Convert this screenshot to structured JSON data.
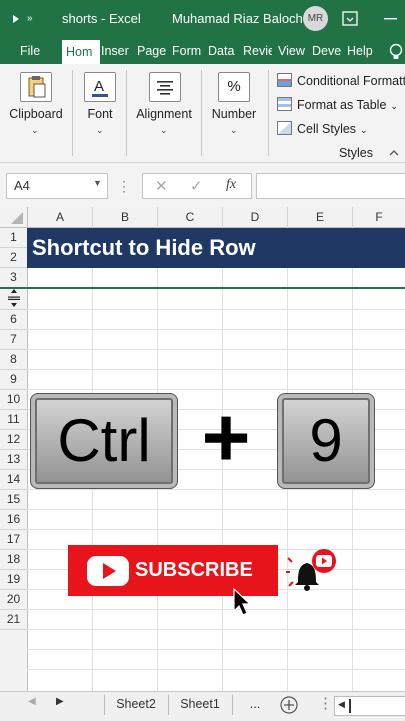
{
  "title_bar": {
    "app_title": "shorts  -  Excel",
    "user_name": "Muhamad Riaz Baloch",
    "user_initials": "MR",
    "accent_color": "#217346"
  },
  "tabs": [
    {
      "label": "File"
    },
    {
      "label": "Hom",
      "active": true
    },
    {
      "label": "Inser"
    },
    {
      "label": "Page"
    },
    {
      "label": "Form"
    },
    {
      "label": "Data"
    },
    {
      "label": "Revie"
    },
    {
      "label": "View"
    },
    {
      "label": "Deve"
    },
    {
      "label": "Help"
    }
  ],
  "ribbon": {
    "clipboard": "Clipboard",
    "font": "Font",
    "alignment": "Alignment",
    "number": "Number",
    "number_glyph": "%",
    "conditional_formatting": "Conditional Formatt",
    "format_as_table": "Format as Table",
    "cell_styles": "Cell Styles",
    "styles_group": "Styles"
  },
  "formula_bar": {
    "name_box": "A4",
    "fx_label": "fx",
    "formula": ""
  },
  "grid": {
    "columns": [
      "A",
      "B",
      "C",
      "D",
      "E",
      "F"
    ],
    "rows": [
      "1",
      "2",
      "3",
      "5",
      "6",
      "7",
      "8",
      "9",
      "10",
      "11",
      "12",
      "13",
      "14",
      "15",
      "16",
      "17",
      "18",
      "19",
      "20",
      "21"
    ]
  },
  "banner": {
    "text": "Shortcut to Hide Row",
    "color": "#203864"
  },
  "keys": {
    "ctrl": "Ctrl",
    "plus": "+",
    "nine": "9"
  },
  "subscribe": {
    "label": "SUBSCRIBE",
    "color": "#e8141b"
  },
  "sheets": {
    "tabs": [
      "Sheet2",
      "Sheet1"
    ],
    "ellipsis": "..."
  }
}
